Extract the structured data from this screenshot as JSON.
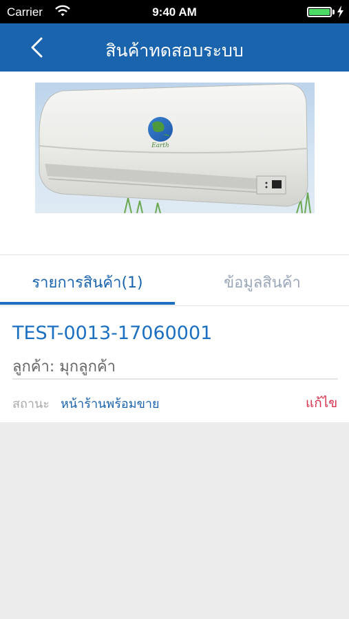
{
  "status_bar": {
    "carrier": "Carrier",
    "time": "9:40 AM"
  },
  "nav": {
    "title": "สินค้าทดสอบระบบ"
  },
  "product_image": {
    "brand_text": "Earth"
  },
  "tabs": [
    {
      "label": "รายการสินค้า(1)",
      "active": true
    },
    {
      "label": "ข้อมูลสินค้า",
      "active": false
    }
  ],
  "item": {
    "code": "TEST-0013-17060001",
    "customer": "ลูกค้า: มุกลูกค้า",
    "status_label": "สถานะ",
    "status_value": "หน้าร้านพร้อมขาย",
    "edit_label": "แก้ไข"
  },
  "colors": {
    "nav": "#1a64ae",
    "accent": "#1a6fc0",
    "edit": "#d6334e"
  }
}
